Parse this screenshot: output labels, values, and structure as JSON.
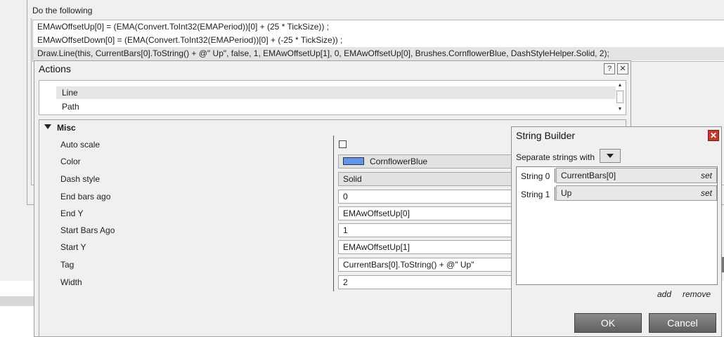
{
  "background": {
    "section_label": "Do the following",
    "code_lines": [
      "EMAwOffsetUp[0] = (EMA(Convert.ToInt32(EMAPeriod))[0] + (25 * TickSize)) ;",
      "EMAwOffsetDown[0] = (EMA(Convert.ToInt32(EMAPeriod))[0] + (-25 * TickSize)) ;",
      "Draw.Line(this, CurrentBars[0].ToString() + @\" Up\", false, 1, EMAwOffsetUp[1], 0, EMAwOffsetUp[0], Brushes.CornflowerBlue, DashStyleHelper.Solid, 2);"
    ]
  },
  "actions": {
    "title": "Actions",
    "help_glyph": "?",
    "close_glyph": "✕",
    "list_items": [
      "Line",
      "Path"
    ],
    "section": "Misc",
    "properties": [
      {
        "name": "Auto scale",
        "value": ""
      },
      {
        "name": "Color",
        "value": "CornflowerBlue"
      },
      {
        "name": "Dash style",
        "value": "Solid"
      },
      {
        "name": "End bars ago",
        "value": "0"
      },
      {
        "name": "End Y",
        "value": "EMAwOffsetUp[0]"
      },
      {
        "name": "Start Bars Ago",
        "value": "1"
      },
      {
        "name": "Start Y",
        "value": "EMAwOffsetUp[1]"
      },
      {
        "name": "Tag",
        "value": "CurrentBars[0].ToString() + @\" Up\""
      },
      {
        "name": "Width",
        "value": "2"
      }
    ],
    "color_swatch": "#6495ED"
  },
  "string_builder": {
    "title": "String Builder",
    "close_glyph": "✕",
    "separator_label": "Separate strings with",
    "rows": [
      {
        "label": "String 0",
        "value": "CurrentBars[0]",
        "action": "set"
      },
      {
        "label": "String 1",
        "value": "Up",
        "action": "set"
      }
    ],
    "add_label": "add",
    "remove_label": "remove",
    "ok_label": "OK",
    "cancel_label": "Cancel"
  }
}
